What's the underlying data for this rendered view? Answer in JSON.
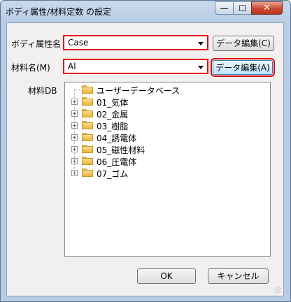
{
  "window": {
    "title": "ボディ属性/材料定数 の設定"
  },
  "controls": {
    "minimize": "—",
    "maximize": "☐",
    "close": "✕"
  },
  "body_attr": {
    "label": "ボディ属性名",
    "value": "Case",
    "edit_button": "データ編集(C)"
  },
  "material": {
    "label": "材料名(M)",
    "value": "Al",
    "edit_button": "データ編集(A)"
  },
  "material_db": {
    "label": "材料DB",
    "tree": [
      {
        "label": "ユーザーデータベース",
        "expandable": false
      },
      {
        "label": "01_気体",
        "expandable": true
      },
      {
        "label": "02_金属",
        "expandable": true
      },
      {
        "label": "03_樹脂",
        "expandable": true
      },
      {
        "label": "04_誘電体",
        "expandable": true
      },
      {
        "label": "05_磁性材料",
        "expandable": true
      },
      {
        "label": "06_圧電体",
        "expandable": true
      },
      {
        "label": "07_ゴム",
        "expandable": true
      }
    ]
  },
  "buttons": {
    "ok": "OK",
    "cancel": "キャンセル"
  },
  "colors": {
    "highlight": "#e0000b",
    "folder": "#f3c95a",
    "title_bar": "#b9cde6"
  }
}
